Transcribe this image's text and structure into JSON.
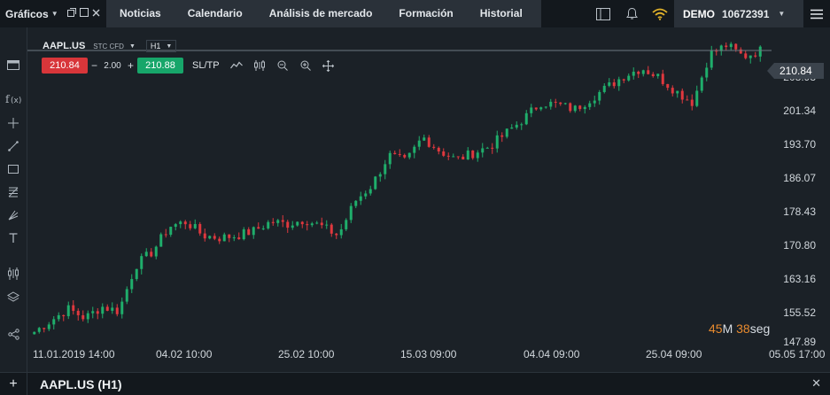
{
  "topbar": {
    "brand_label": "Gráficos",
    "tabs": [
      "Noticias",
      "Calendario",
      "Análisis de mercado",
      "Formación",
      "Historial"
    ],
    "account_mode": "DEMO",
    "account_number": "10672391",
    "icons": [
      "window-restore-icon",
      "window-maximize-icon",
      "layout-icon",
      "bell-icon",
      "wifi-icon",
      "hamburger-menu-icon"
    ]
  },
  "trading": {
    "symbol": "AAPL.US",
    "instrument_type": "STC CFD",
    "timeframe": "H1",
    "sell_price": "210.84",
    "volume": "2.00",
    "buy_price": "210.88",
    "sltp_label": "SL/TP"
  },
  "axis": {
    "y_labels": [
      "208.98",
      "201.34",
      "193.70",
      "186.07",
      "178.43",
      "170.80",
      "163.16",
      "155.52",
      "147.89"
    ],
    "x_labels": [
      "11.01.2019 14:00",
      "04.02 10:00",
      "25.02 10:00",
      "15.03 09:00",
      "04.04 09:00",
      "25.04 09:00",
      "05.05 17:00"
    ],
    "current_price": "210.84"
  },
  "timer": {
    "minutes": "45",
    "minutes_unit": "M",
    "seconds": "38",
    "seconds_unit": "seg"
  },
  "bottombar": {
    "title": "AAPL.US (H1)"
  },
  "colors": {
    "bull": "#1fae6b",
    "bear": "#e0383e",
    "background": "#1b2127",
    "accent_orange": "#e88a2e"
  },
  "chart_data": {
    "type": "candlestick",
    "symbol": "AAPL.US",
    "timeframe": "H1",
    "x": [
      "11.01.2019 14:00",
      "04.02 10:00",
      "25.02 10:00",
      "15.03 09:00",
      "04.04 09:00",
      "25.04 09:00",
      "05.05 17:00"
    ],
    "ylim": [
      147.89,
      212.0
    ],
    "close_path": [
      [
        "11.01.2019 14:00",
        149.5
      ],
      [
        "16.01",
        152.0
      ],
      [
        "21.01",
        154.5
      ],
      [
        "25.01",
        152.5
      ],
      [
        "29.01",
        155.0
      ],
      [
        "30.01",
        154.0
      ],
      [
        "31.01",
        164.0
      ],
      [
        "01.02",
        167.0
      ],
      [
        "04.02 10:00",
        172.5
      ],
      [
        "06.02",
        173.5
      ],
      [
        "08.02",
        170.5
      ],
      [
        "12.02",
        170.0
      ],
      [
        "15.02",
        170.5
      ],
      [
        "20.02",
        171.5
      ],
      [
        "25.02 10:00",
        173.5
      ],
      [
        "28.02",
        173.0
      ],
      [
        "04.03",
        174.0
      ],
      [
        "08.03",
        172.5
      ],
      [
        "11.03",
        170.5
      ],
      [
        "12.03",
        178.0
      ],
      [
        "13.03",
        181.5
      ],
      [
        "15.03 09:00",
        188.0
      ],
      [
        "18.03",
        186.5
      ],
      [
        "20.03",
        192.0
      ],
      [
        "22.03",
        189.0
      ],
      [
        "25.03",
        187.0
      ],
      [
        "27.03",
        188.5
      ],
      [
        "29.03",
        190.0
      ],
      [
        "01.04",
        193.0
      ],
      [
        "02.04",
        196.0
      ],
      [
        "04.04 09:00",
        199.5
      ],
      [
        "08.04",
        199.0
      ],
      [
        "10.04",
        198.0
      ],
      [
        "12.04",
        200.5
      ],
      [
        "16.04",
        203.0
      ],
      [
        "18.04",
        205.5
      ],
      [
        "22.04",
        207.0
      ],
      [
        "23.04",
        205.0
      ],
      [
        "24.04",
        202.0
      ],
      [
        "25.04 09:00",
        199.5
      ],
      [
        "30.04",
        210.0
      ],
      [
        "01.05",
        212.0
      ],
      [
        "02.05",
        209.5
      ],
      [
        "03.05",
        210.84
      ]
    ],
    "grid": false,
    "last_price": 210.84
  }
}
